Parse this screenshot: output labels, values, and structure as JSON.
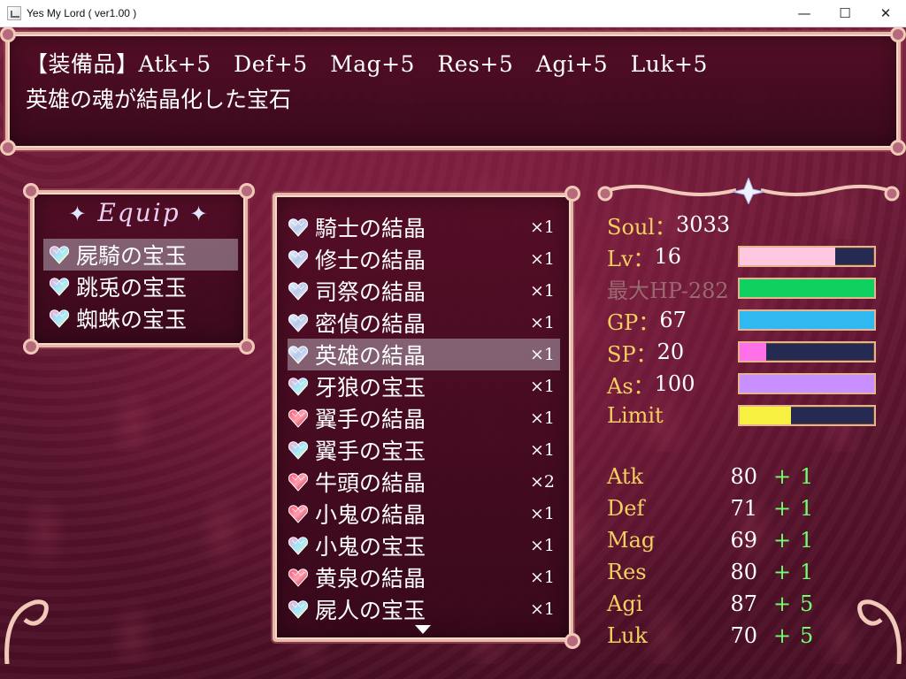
{
  "window": {
    "title": "Yes My Lord ( ver1.00 )",
    "minimize_glyph": "—",
    "maximize_glyph": "☐",
    "close_glyph": "✕"
  },
  "help": {
    "line1": "【装備品】Atk+5　Def+5　Mag+5　Res+5　Agi+5　Luk+5",
    "line2": "英雄の魂が結晶化した宝石"
  },
  "category": {
    "header": "Equip",
    "sparkle": "✦",
    "items": [
      {
        "label": "屍騎の宝玉",
        "selected": true,
        "gem": "rainbow"
      },
      {
        "label": "跳兎の宝玉",
        "selected": false,
        "gem": "rainbow"
      },
      {
        "label": "蜘蛛の宝玉",
        "selected": false,
        "gem": "rainbow"
      }
    ]
  },
  "items": {
    "list": [
      {
        "name": "騎士の結晶",
        "qty": "×1",
        "gem": "silver",
        "selected": false
      },
      {
        "name": "修士の結晶",
        "qty": "×1",
        "gem": "silver",
        "selected": false
      },
      {
        "name": "司祭の結晶",
        "qty": "×1",
        "gem": "silver",
        "selected": false
      },
      {
        "name": "密偵の結晶",
        "qty": "×1",
        "gem": "silver",
        "selected": false
      },
      {
        "name": "英雄の結晶",
        "qty": "×1",
        "gem": "silver",
        "selected": true
      },
      {
        "name": "牙狼の宝玉",
        "qty": "×1",
        "gem": "rainbow",
        "selected": false
      },
      {
        "name": "翼手の結晶",
        "qty": "×1",
        "gem": "red",
        "selected": false
      },
      {
        "name": "翼手の宝玉",
        "qty": "×1",
        "gem": "rainbow",
        "selected": false
      },
      {
        "name": "牛頭の結晶",
        "qty": "×2",
        "gem": "red",
        "selected": false
      },
      {
        "name": "小鬼の結晶",
        "qty": "×1",
        "gem": "red",
        "selected": false
      },
      {
        "name": "小鬼の宝玉",
        "qty": "×1",
        "gem": "rainbow",
        "selected": false
      },
      {
        "name": "黄泉の結晶",
        "qty": "×1",
        "gem": "red",
        "selected": false
      },
      {
        "name": "屍人の宝玉",
        "qty": "×1",
        "gem": "rainbow",
        "selected": false
      }
    ]
  },
  "status": {
    "soul_label": "Soul：",
    "soul_value": "3033",
    "gauges": [
      {
        "label": "Lv：",
        "value": "16",
        "fill": 0.71,
        "color": "#ffc8e0"
      },
      {
        "label": "最大HP-282",
        "value": "",
        "fill": 1.0,
        "color": "#10d060",
        "dim": true
      },
      {
        "label": "GP：",
        "value": "67",
        "fill": 1.0,
        "color": "#30b8f0"
      },
      {
        "label": "SP：",
        "value": "20",
        "fill": 0.2,
        "color": "#ff70e8"
      },
      {
        "label": "As：",
        "value": "100",
        "fill": 1.0,
        "color": "#c890ff"
      },
      {
        "label": "Limit",
        "value": "",
        "fill": 0.38,
        "color": "#f8f040"
      }
    ],
    "params": [
      {
        "label": "Atk",
        "base": "80",
        "plus": "+",
        "bonus": "1"
      },
      {
        "label": "Def",
        "base": "71",
        "plus": "+",
        "bonus": "1"
      },
      {
        "label": "Mag",
        "base": "69",
        "plus": "+",
        "bonus": "1"
      },
      {
        "label": "Res",
        "base": "80",
        "plus": "+",
        "bonus": "1"
      },
      {
        "label": "Agi",
        "base": "87",
        "plus": "+",
        "bonus": "5"
      },
      {
        "label": "Luk",
        "base": "70",
        "plus": "+",
        "bonus": "5"
      }
    ]
  }
}
